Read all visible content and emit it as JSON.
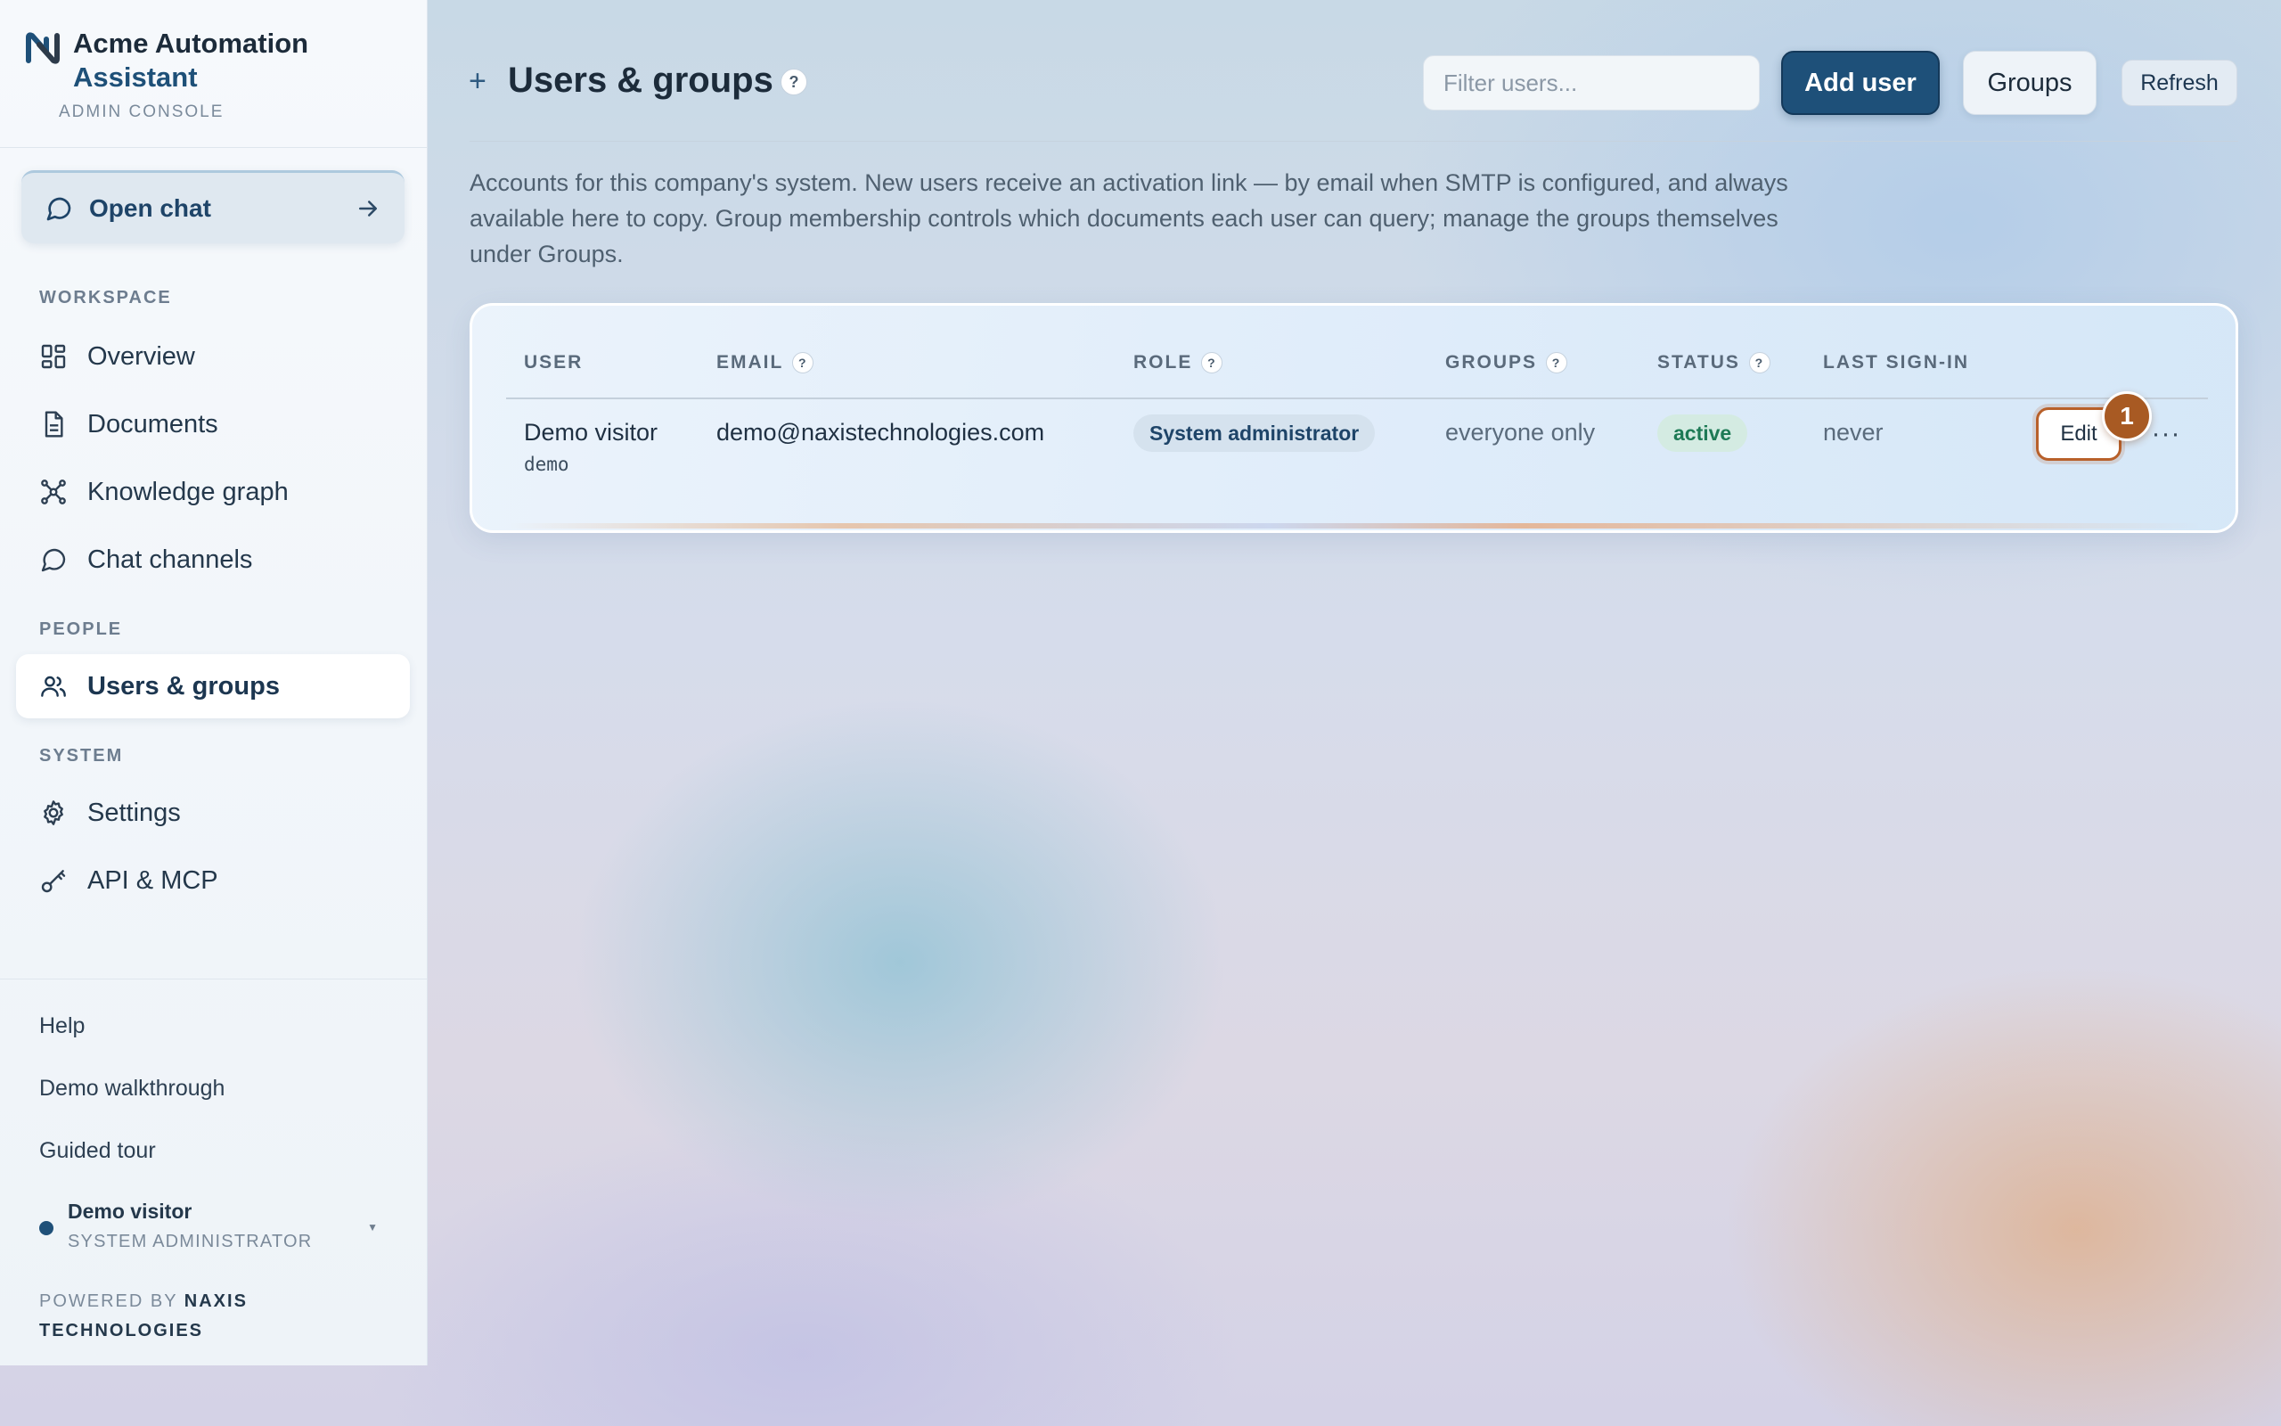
{
  "brand": {
    "name_line1": "Acme Automation",
    "name_line2": "Assistant",
    "subtitle": "ADMIN CONSOLE"
  },
  "sidebar": {
    "open_chat": "Open chat",
    "sections": {
      "workspace": "WORKSPACE",
      "people": "PEOPLE",
      "system": "SYSTEM"
    },
    "workspace_items": [
      {
        "label": "Overview",
        "icon": "grid-icon"
      },
      {
        "label": "Documents",
        "icon": "document-icon"
      },
      {
        "label": "Knowledge graph",
        "icon": "graph-icon"
      },
      {
        "label": "Chat channels",
        "icon": "chat-bubble-icon"
      }
    ],
    "people_items": [
      {
        "label": "Users & groups",
        "icon": "users-icon",
        "active": true
      }
    ],
    "system_items": [
      {
        "label": "Settings",
        "icon": "gear-icon"
      },
      {
        "label": "API & MCP",
        "icon": "key-icon"
      }
    ],
    "bottom_links": [
      "Help",
      "Demo walkthrough",
      "Guided tour"
    ],
    "user": {
      "name": "Demo visitor",
      "role": "SYSTEM ADMINISTRATOR"
    },
    "powered_by_prefix": "POWERED BY",
    "powered_by_name": "NAXIS TECHNOLOGIES"
  },
  "header": {
    "plus": "+",
    "title": "Users & groups",
    "help": "?",
    "filter_placeholder": "Filter users...",
    "filter_value": "",
    "add_user": "Add user",
    "groups": "Groups",
    "refresh": "Refresh"
  },
  "intro": "Accounts for this company's system. New users receive an activation link — by email when SMTP is configured, and always available here to copy. Group membership controls which documents each user can query; manage the groups themselves under Groups.",
  "table": {
    "columns": {
      "user": "USER",
      "email": "EMAIL",
      "role": "ROLE",
      "groups": "GROUPS",
      "status": "STATUS",
      "last_sign_in": "LAST SIGN-IN"
    },
    "rows": [
      {
        "name": "Demo visitor",
        "username": "demo",
        "email": "demo@naxistechnologies.com",
        "role": "System administrator",
        "groups": "everyone only",
        "status": "active",
        "last_sign_in": "never",
        "edit": "Edit",
        "more": "···"
      }
    ]
  },
  "tour_badge": "1",
  "colors": {
    "primary": "#1e5079",
    "accent_orange": "#a85a23",
    "status_active": "#1d7a55"
  }
}
